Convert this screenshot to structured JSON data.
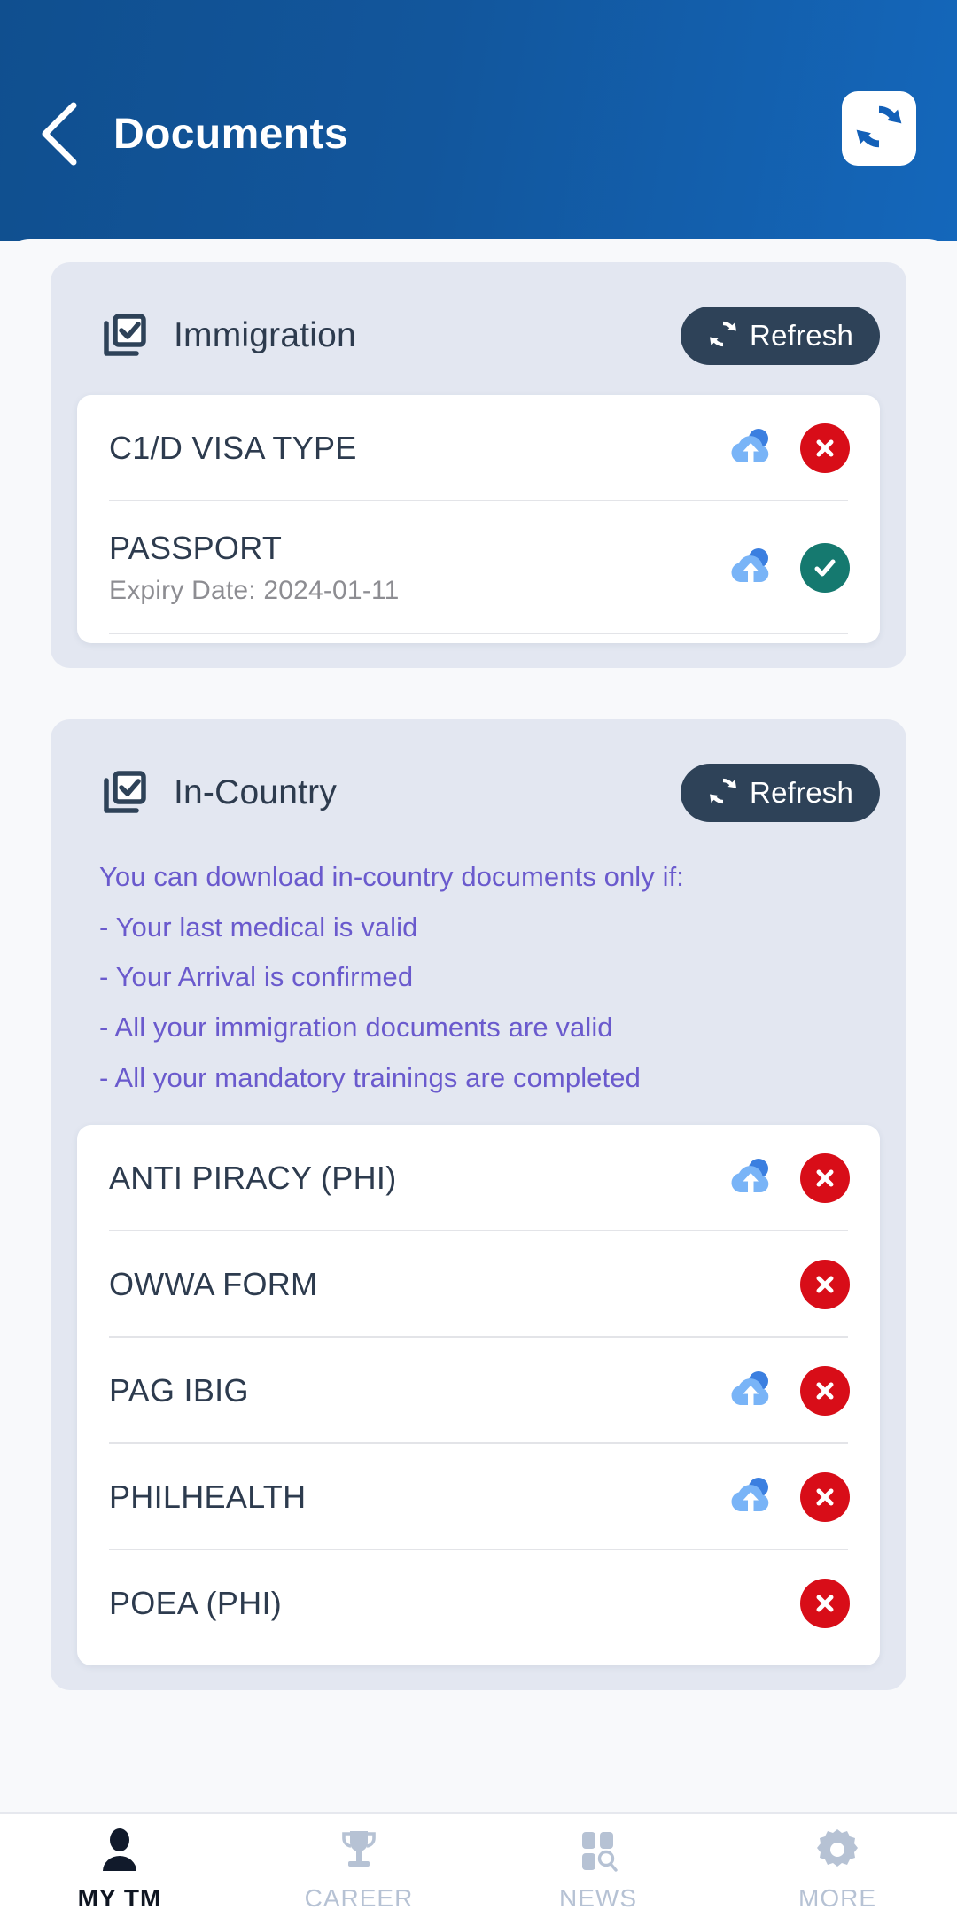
{
  "header": {
    "title": "Documents",
    "back_icon": "chevron-left-icon",
    "refresh_icon": "refresh-sync-icon"
  },
  "sections": [
    {
      "id": "immigration",
      "title": "Immigration",
      "icon": "documents-check-icon",
      "refresh_label": "Refresh",
      "documents": [
        {
          "title": "C1/D VISA TYPE",
          "subtitle": "",
          "upload_icon": "cloud-upload-icon",
          "has_upload": true,
          "status": "invalid",
          "status_icon": "close-circle-icon"
        },
        {
          "title": "PASSPORT",
          "subtitle": "Expiry Date: 2024-01-11",
          "upload_icon": "cloud-upload-icon",
          "has_upload": true,
          "status": "valid",
          "status_icon": "check-circle-icon"
        }
      ]
    },
    {
      "id": "in-country",
      "title": "In-Country",
      "icon": "documents-check-icon",
      "refresh_label": "Refresh",
      "notice": [
        "You can download in-country documents only if:",
        "- Your last medical is valid",
        "- Your Arrival is confirmed",
        "- All your immigration documents are valid",
        "- All your mandatory trainings are completed"
      ],
      "documents": [
        {
          "title": "ANTI PIRACY (PHI)",
          "subtitle": "",
          "upload_icon": "cloud-upload-icon",
          "has_upload": true,
          "status": "invalid",
          "status_icon": "close-circle-icon"
        },
        {
          "title": "OWWA FORM",
          "subtitle": "",
          "upload_icon": "",
          "has_upload": false,
          "status": "invalid",
          "status_icon": "close-circle-icon"
        },
        {
          "title": "PAG IBIG",
          "subtitle": "",
          "upload_icon": "cloud-upload-icon",
          "has_upload": true,
          "status": "invalid",
          "status_icon": "close-circle-icon"
        },
        {
          "title": "PHILHEALTH",
          "subtitle": "",
          "upload_icon": "cloud-upload-icon",
          "has_upload": true,
          "status": "invalid",
          "status_icon": "close-circle-icon"
        },
        {
          "title": "POEA (PHI)",
          "subtitle": "",
          "upload_icon": "",
          "has_upload": false,
          "status": "invalid",
          "status_icon": "close-circle-icon"
        }
      ]
    }
  ],
  "bottom_nav": [
    {
      "label": "MY TM",
      "icon": "person-icon",
      "active": true
    },
    {
      "label": "CAREER",
      "icon": "trophy-icon",
      "active": false
    },
    {
      "label": "NEWS",
      "icon": "news-grid-search-icon",
      "active": false
    },
    {
      "label": "MORE",
      "icon": "gear-icon",
      "active": false
    }
  ],
  "colors": {
    "header_blue": "#12569c",
    "section_bg": "#e3e7f1",
    "refresh_pill": "#2e4258",
    "notice_purple": "#6a5acd",
    "status_invalid": "#d80d18",
    "status_valid": "#15796f",
    "cloud_light": "#79b4f7",
    "cloud_dark": "#3b7fe0",
    "nav_inactive": "#b6c2d4",
    "nav_active": "#0f1622"
  }
}
